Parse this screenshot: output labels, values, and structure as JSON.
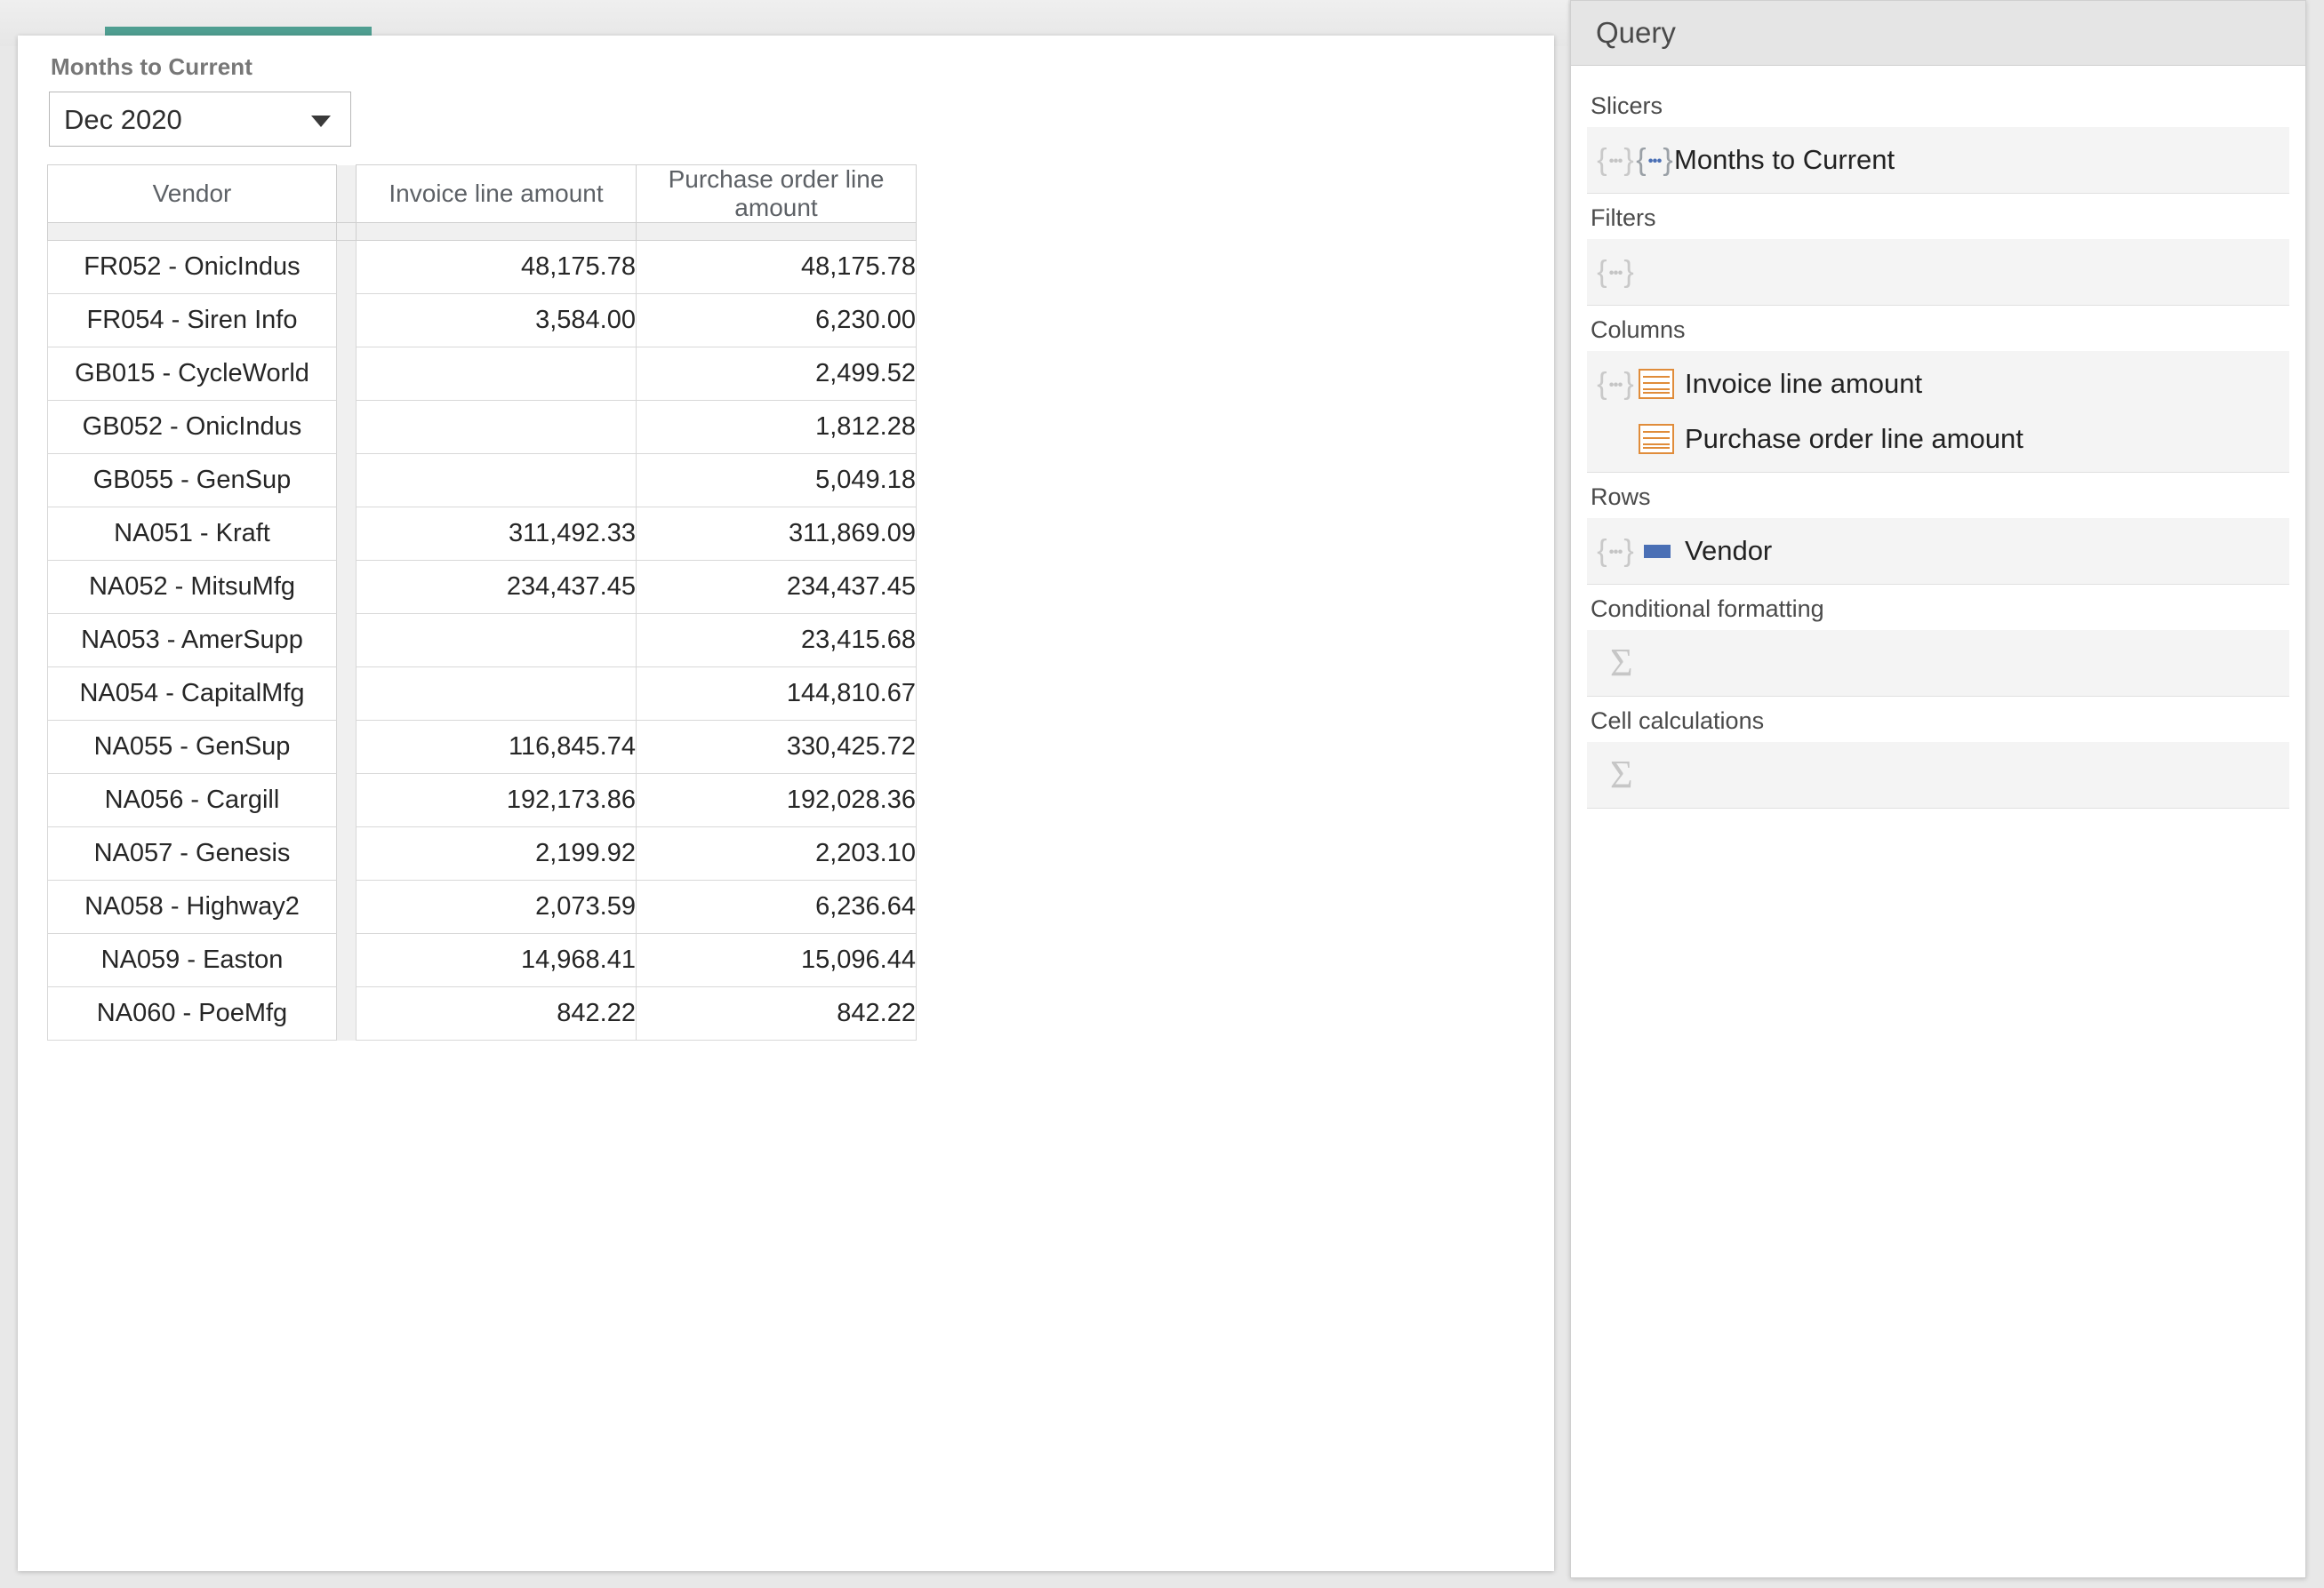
{
  "slicer": {
    "label": "Months to Current",
    "selected_value": "Dec 2020",
    "caret_icon": "chevron-down-icon"
  },
  "table": {
    "headers": {
      "vendor": "Vendor",
      "invoice": "Invoice line amount",
      "purchase_order": "Purchase order line amount"
    },
    "rows": [
      {
        "vendor": "FR052 - OnicIndus",
        "invoice": "48,175.78",
        "purchase_order": "48,175.78"
      },
      {
        "vendor": "FR054 - Siren Info",
        "invoice": "3,584.00",
        "purchase_order": "6,230.00"
      },
      {
        "vendor": "GB015 - CycleWorld",
        "invoice": "",
        "purchase_order": "2,499.52"
      },
      {
        "vendor": "GB052 - OnicIndus",
        "invoice": "",
        "purchase_order": "1,812.28"
      },
      {
        "vendor": "GB055 - GenSup",
        "invoice": "",
        "purchase_order": "5,049.18"
      },
      {
        "vendor": "NA051 - Kraft",
        "invoice": "311,492.33",
        "purchase_order": "311,869.09"
      },
      {
        "vendor": "NA052 - MitsuMfg",
        "invoice": "234,437.45",
        "purchase_order": "234,437.45"
      },
      {
        "vendor": "NA053 - AmerSupp",
        "invoice": "",
        "purchase_order": "23,415.68"
      },
      {
        "vendor": "NA054 - CapitalMfg",
        "invoice": "",
        "purchase_order": "144,810.67"
      },
      {
        "vendor": "NA055 - GenSup",
        "invoice": "116,845.74",
        "purchase_order": "330,425.72"
      },
      {
        "vendor": "NA056 - Cargill",
        "invoice": "192,173.86",
        "purchase_order": "192,028.36"
      },
      {
        "vendor": "NA057 - Genesis",
        "invoice": "2,199.92",
        "purchase_order": "2,203.10"
      },
      {
        "vendor": "NA058 - Highway2",
        "invoice": "2,073.59",
        "purchase_order": "6,236.64"
      },
      {
        "vendor": "NA059 - Easton",
        "invoice": "14,968.41",
        "purchase_order": "15,096.44"
      },
      {
        "vendor": "NA060 - PoeMfg",
        "invoice": "842.22",
        "purchase_order": "842.22"
      }
    ]
  },
  "query_panel": {
    "title": "Query",
    "sections": {
      "slicers": {
        "label": "Slicers",
        "items": [
          {
            "label": "Months to Current",
            "icon": "braces-set-icon"
          }
        ]
      },
      "filters": {
        "label": "Filters",
        "items": []
      },
      "columns": {
        "label": "Columns",
        "items": [
          {
            "label": "Invoice line amount",
            "icon": "measure-icon"
          },
          {
            "label": "Purchase order line amount",
            "icon": "measure-icon"
          }
        ]
      },
      "rows": {
        "label": "Rows",
        "items": [
          {
            "label": "Vendor",
            "icon": "dimension-icon"
          }
        ]
      },
      "conditional_formatting": {
        "label": "Conditional formatting",
        "placeholder_icon": "sigma-icon"
      },
      "cell_calculations": {
        "label": "Cell calculations",
        "placeholder_icon": "sigma-icon"
      }
    }
  },
  "colors": {
    "active_tab": "#4f9e91",
    "measure_icon": "#e08c3a",
    "dimension_icon": "#4a6fb5",
    "panel_header": "#e5e5e5"
  }
}
